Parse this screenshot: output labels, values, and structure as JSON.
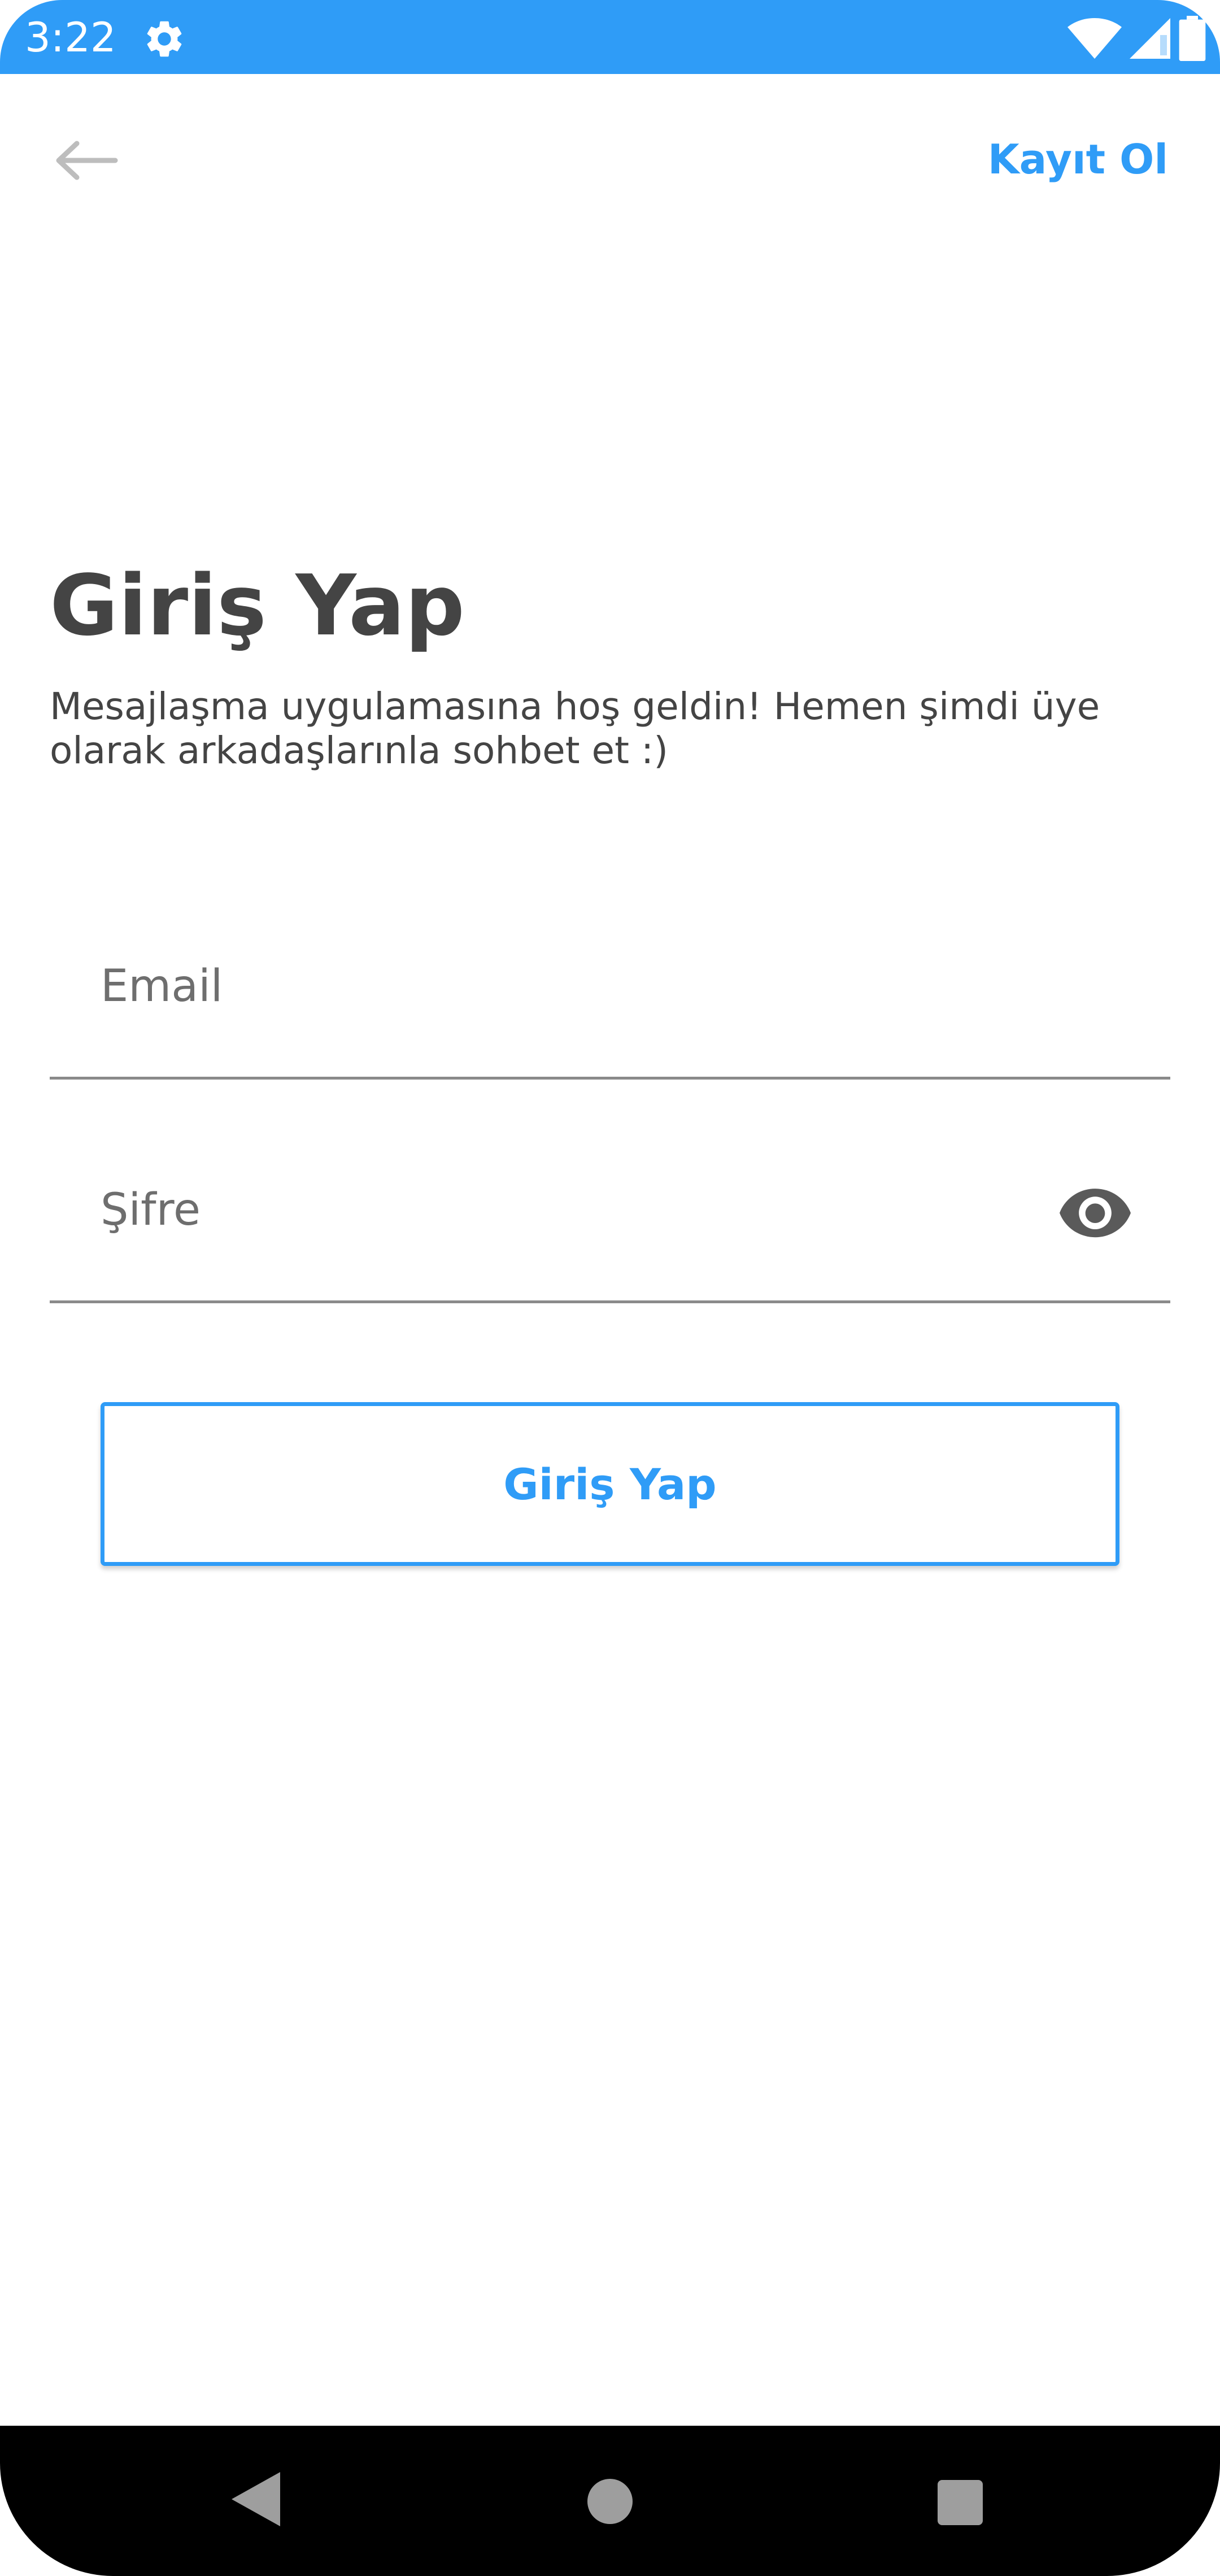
{
  "status_bar": {
    "time": "3:22",
    "background_color": "#2f9cf7",
    "icons": [
      "gear-icon",
      "wifi-icon",
      "signal-icon",
      "battery-icon"
    ]
  },
  "header": {
    "back_icon": "arrow-left-icon",
    "register_label": "Kayıt Ol"
  },
  "main": {
    "title": "Giriş Yap",
    "subtitle": "Mesajlaşma uygulamasına hoş geldin! Hemen şimdi üye olarak arkadaşlarınla sohbet et :)"
  },
  "form": {
    "email": {
      "value": "",
      "placeholder": "Email"
    },
    "password": {
      "value": "",
      "placeholder": "Şifre",
      "toggle_icon": "eye-icon"
    },
    "submit_label": "Giriş Yap"
  },
  "nav_bar": {
    "icons": [
      "nav-back-icon",
      "nav-home-icon",
      "nav-recents-icon"
    ]
  },
  "colors": {
    "accent": "#2f9cf7",
    "text": "#444444",
    "divider": "#8a8a8a"
  }
}
